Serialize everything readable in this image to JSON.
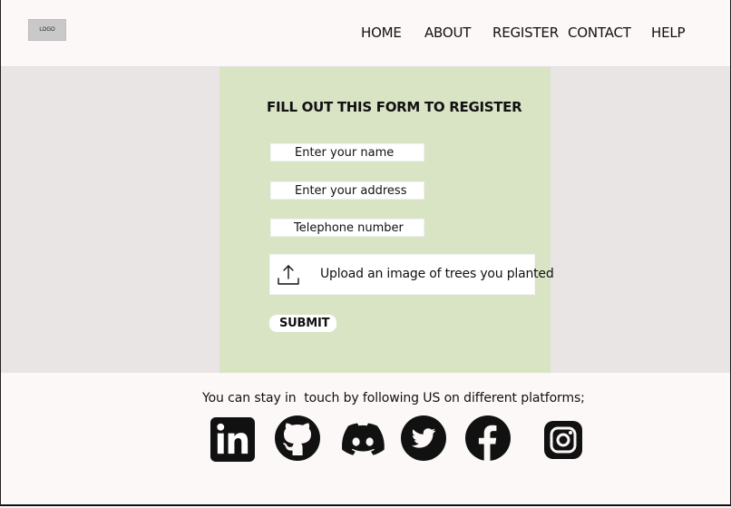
{
  "header": {
    "logo_text": "LOGO",
    "nav": {
      "home": "HOME",
      "about": "ABOUT",
      "register": "REGISTER",
      "contact": "CONTACT",
      "help": "HELP"
    }
  },
  "form": {
    "title": "FILL OUT THIS FORM TO REGISTER",
    "name_placeholder": "Enter your name",
    "address_placeholder": "Enter your address",
    "phone_placeholder": "Telephone number",
    "upload_label": "Upload an image of trees you planted",
    "submit_label": "SUBMIT"
  },
  "footer": {
    "text": "You can stay in  touch by following US on different platforms;",
    "socials": [
      "linkedin-icon",
      "github-icon",
      "discord-icon",
      "twitter-icon",
      "facebook-icon",
      "instagram-icon"
    ]
  },
  "colors": {
    "page_bg": "#fcf8f7",
    "band_bg": "#e8e5e4",
    "form_bg": "#d9e4c5",
    "logo_bg": "#c9c9c9"
  }
}
